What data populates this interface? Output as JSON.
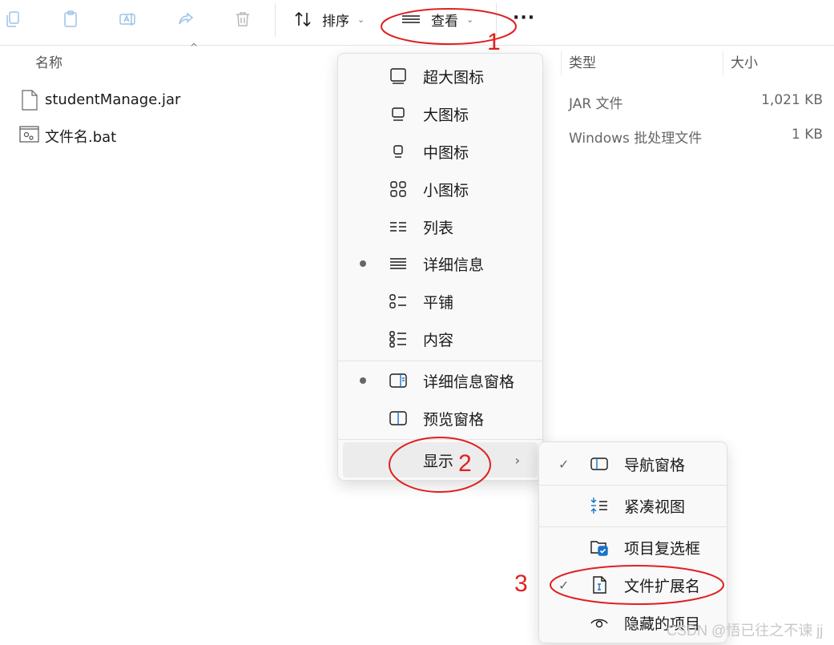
{
  "toolbar": {
    "sort_label": "排序",
    "view_label": "查看",
    "more_label": "···",
    "icons": [
      "copy-icon",
      "paste-icon",
      "rename-icon",
      "share-icon",
      "delete-icon"
    ]
  },
  "columns": {
    "name": "名称",
    "type": "类型",
    "size": "大小"
  },
  "files": [
    {
      "name": "studentManage.jar",
      "type": "JAR 文件",
      "size": "1,021 KB",
      "icon": "file-icon"
    },
    {
      "name": "文件名.bat",
      "type": "Windows 批处理文件",
      "size": "1 KB",
      "icon": "batch-file-icon"
    }
  ],
  "view_menu": {
    "items": [
      {
        "label": "超大图标",
        "icon": "extra-large-icons-icon",
        "selected": false
      },
      {
        "label": "大图标",
        "icon": "large-icons-icon",
        "selected": false
      },
      {
        "label": "中图标",
        "icon": "medium-icons-icon",
        "selected": false
      },
      {
        "label": "小图标",
        "icon": "small-icons-icon",
        "selected": false
      },
      {
        "label": "列表",
        "icon": "list-icon",
        "selected": false
      },
      {
        "label": "详细信息",
        "icon": "details-icon",
        "selected": true
      },
      {
        "label": "平铺",
        "icon": "tiles-icon",
        "selected": false
      },
      {
        "label": "内容",
        "icon": "content-icon",
        "selected": false
      }
    ],
    "panes": [
      {
        "label": "详细信息窗格",
        "icon": "details-pane-icon",
        "selected": true
      },
      {
        "label": "预览窗格",
        "icon": "preview-pane-icon",
        "selected": false
      }
    ],
    "show_label": "显示"
  },
  "show_menu": {
    "items": [
      {
        "label": "导航窗格",
        "icon": "navigation-pane-icon",
        "checked": true
      },
      {
        "label": "紧凑视图",
        "icon": "compact-view-icon",
        "checked": false
      },
      {
        "label": "项目复选框",
        "icon": "item-checkbox-icon",
        "checked": false
      },
      {
        "label": "文件扩展名",
        "icon": "file-extension-icon",
        "checked": true
      },
      {
        "label": "隐藏的项目",
        "icon": "hidden-items-icon",
        "checked": false
      }
    ]
  },
  "annotations": {
    "n1": "1",
    "n2": "2",
    "n3": "3",
    "color": "#e02020"
  },
  "watermark": "CSDN @悟已往之不谏 jj"
}
